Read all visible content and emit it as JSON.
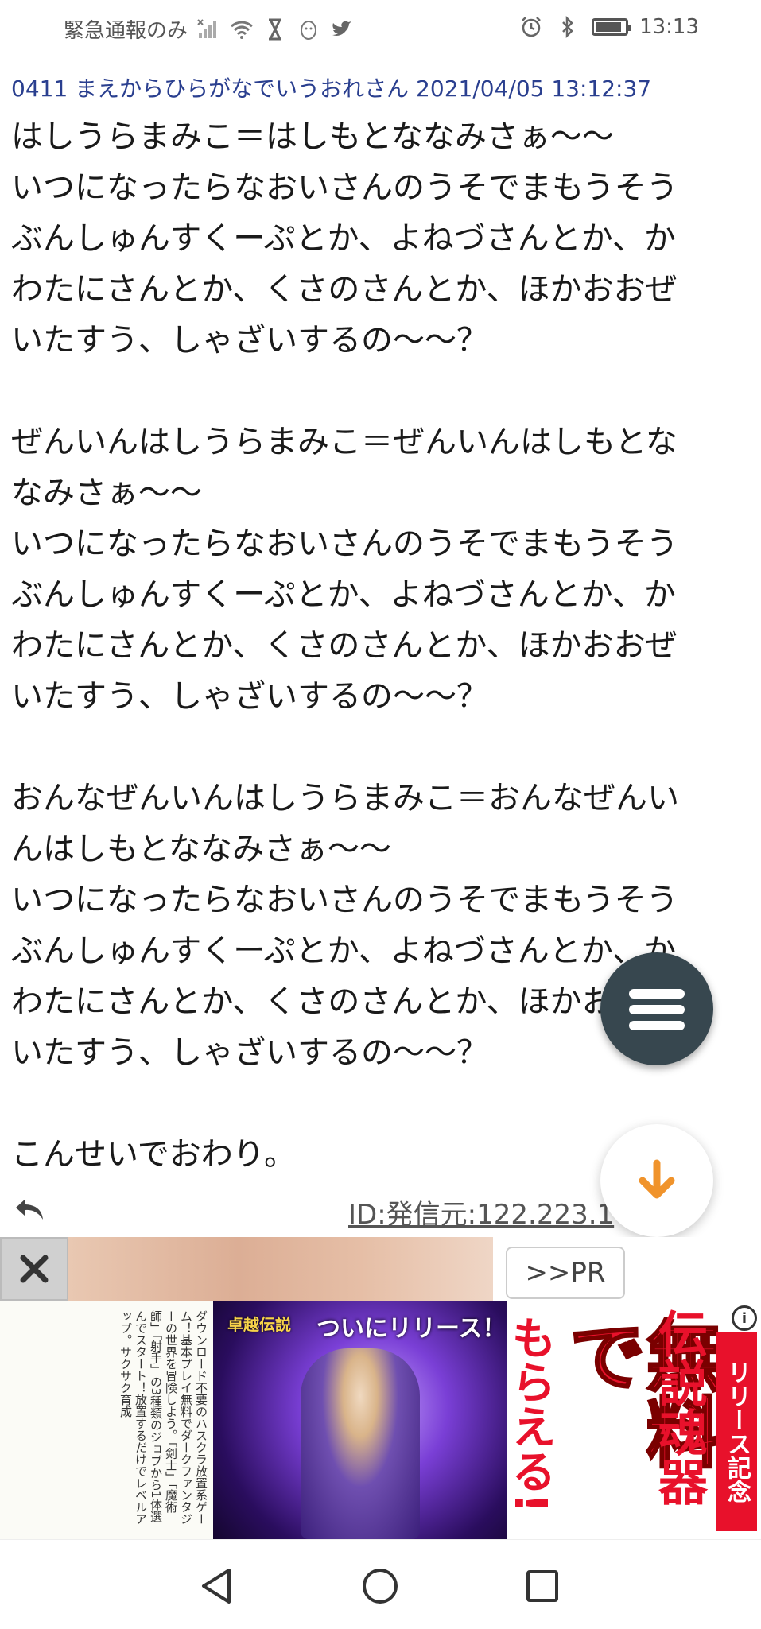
{
  "status_bar": {
    "carrier_text": "緊急通報のみ",
    "time": "13:13"
  },
  "post": {
    "header": "0411 まえからひらがなでいうおれさん 2021/04/05 13:12:37",
    "lines": [
      "はしうらまみこ＝はしもとななみさぁ〜〜",
      "いつになったらなおいさんのうそでまもうそう",
      "ぶんしゅんすくーぷとか、よねづさんとか、か",
      "わたにさんとか、くさのさんとか、ほかおおぜ",
      "いたすう、しゃざいするの〜〜？",
      "",
      "ぜんいんはしうらまみこ＝ぜんいんはしもとな",
      "なみさぁ〜〜",
      "いつになったらなおいさんのうそでまもうそう",
      "ぶんしゅんすくーぷとか、よねづさんとか、か",
      "わたにさんとか、くさのさんとか、ほかおおぜ",
      "いたすう、しゃざいするの〜〜？",
      "",
      "おんなぜんいんはしうらまみこ＝おんなぜんい",
      "んはしもとななみさぁ〜〜",
      "いつになったらなおいさんのうそでまもうそう",
      "ぶんしゅんすくーぷとか、よねづさんとか、か",
      "わたにさんとか、くさのさんとか、ほかおおぜ",
      "いたすう、しゃざいするの〜〜？",
      "",
      "こんせいでおわり。"
    ],
    "id_text": "ID:発信元:122.223.1"
  },
  "ad": {
    "pr_label": ">>PR",
    "left_text": "ダウンロード不要のハスクラ放置系ゲーム！基本プレイ無料でダークファンタジーの世界を冒険しよう。「剣士」「魔術師」「射手」の3種類のジョブから1体選んでスタート！放置するだけでレベルアップ。サクサク育成",
    "logo": "卓越伝説",
    "release_text": "ついにリリース！",
    "big_free": "無料で",
    "get_text": "もらえる!",
    "legend_text": "伝説魂器",
    "commemoration": "リリース記念"
  },
  "colors": {
    "header_blue": "#2a3f8f",
    "fab_dark": "#37474f",
    "arrow_orange": "#f0932b",
    "ad_red": "#e8112b"
  }
}
